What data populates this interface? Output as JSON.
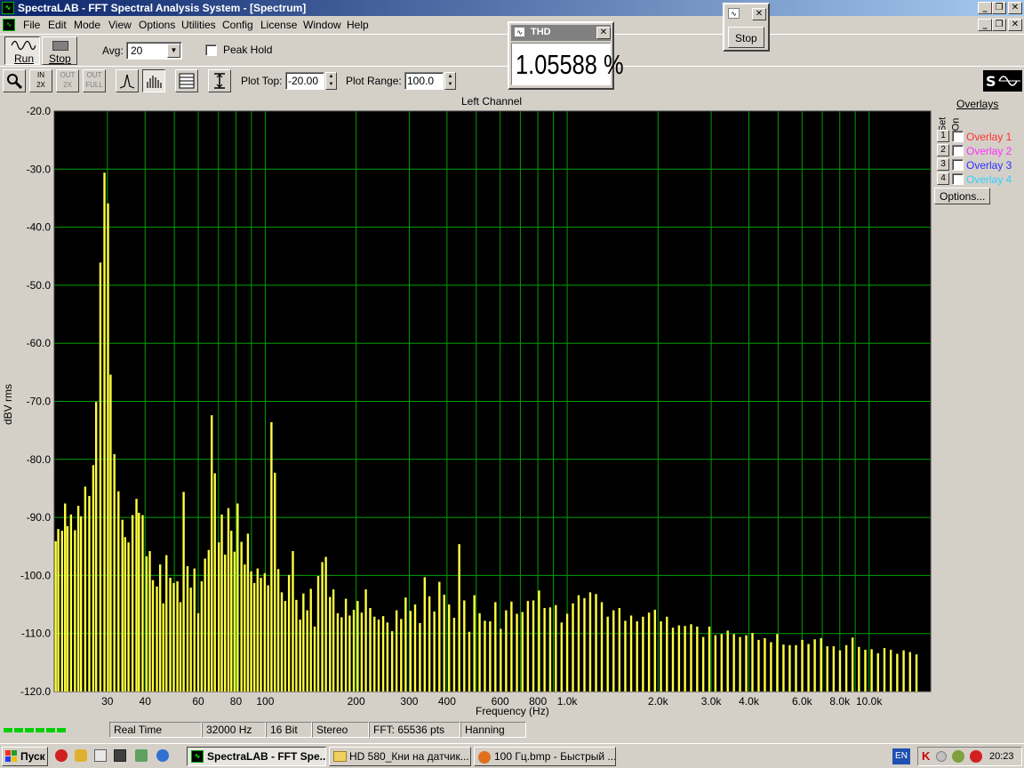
{
  "window": {
    "title": "SpectraLAB - FFT Spectral Analysis System - [Spectrum]"
  },
  "menu": [
    "File",
    "Edit",
    "Mode",
    "View",
    "Options",
    "Utilities",
    "Config",
    "License",
    "Window",
    "Help"
  ],
  "toolbar1": {
    "run_label": "Run",
    "stop_label": "Stop",
    "avg_label": "Avg:",
    "avg_value": "20",
    "peak_hold_label": "Peak Hold"
  },
  "toolbar2": {
    "plot_top_label": "Plot Top:",
    "plot_top_value": "-20.00",
    "plot_range_label": "Plot Range:",
    "plot_range_value": "100.0"
  },
  "thd_window": {
    "title": "THD",
    "value": "1.05588 %"
  },
  "stop_window": {
    "button_label": "Stop"
  },
  "overlays": {
    "title": "Overlays",
    "set_label": "Set",
    "on_label": "On",
    "items": [
      {
        "num": "1",
        "label": "Overlay 1",
        "color": "#ff3030"
      },
      {
        "num": "2",
        "label": "Overlay 2",
        "color": "#ff30ff"
      },
      {
        "num": "3",
        "label": "Overlay 3",
        "color": "#3030ff"
      },
      {
        "num": "4",
        "label": "Overlay 4",
        "color": "#30d0ff"
      }
    ],
    "options_label": "Options..."
  },
  "status": {
    "mode": "Real Time",
    "rate": "32000 Hz",
    "bits": "16 Bit",
    "channels": "Stereo",
    "fft": "FFT: 65536 pts",
    "window": "Hanning"
  },
  "taskbar": {
    "start_label": "Пуск",
    "tasks": [
      "SpectraLAB - FFT Spe...",
      "HD 580_Кни на датчик...",
      "100 Гц.bmp - Быстрый ..."
    ],
    "lang": "EN",
    "clock": "20:23"
  },
  "chart_data": {
    "type": "bar",
    "title": "Left Channel",
    "xlabel": "Frequency (Hz)",
    "ylabel": "dBV rms",
    "ylim": [
      -120,
      -20
    ],
    "xlim": [
      20,
      16000
    ],
    "x_scale": "log",
    "grid": true,
    "bar_color": "#ffff40",
    "background": "#000000",
    "grid_color": "#00a000",
    "yticks": [
      "-20.0",
      "-30.0",
      "-40.0",
      "-50.0",
      "-60.0",
      "-70.0",
      "-80.0",
      "-90.0",
      "-100.0",
      "-110.0",
      "-120.0"
    ],
    "xticks": [
      {
        "v": 30,
        "t": "30"
      },
      {
        "v": 40,
        "t": "40"
      },
      {
        "v": 60,
        "t": "60"
      },
      {
        "v": 80,
        "t": "80"
      },
      {
        "v": 100,
        "t": "100"
      },
      {
        "v": 200,
        "t": "200"
      },
      {
        "v": 300,
        "t": "300"
      },
      {
        "v": 400,
        "t": "400"
      },
      {
        "v": 600,
        "t": "600"
      },
      {
        "v": 800,
        "t": "800"
      },
      {
        "v": 1000,
        "t": "1.0k"
      },
      {
        "v": 2000,
        "t": "2.0k"
      },
      {
        "v": 3000,
        "t": "3.0k"
      },
      {
        "v": 4000,
        "t": "4.0k"
      },
      {
        "v": 6000,
        "t": "6.0k"
      },
      {
        "v": 8000,
        "t": "8.0k"
      },
      {
        "v": 10000,
        "t": "10.0k"
      }
    ],
    "x": [
      20.2,
      20.6,
      21.2,
      21.7,
      22.1,
      22.7,
      23.4,
      24,
      24.5,
      25.3,
      26.1,
      26.9,
      27.5,
      28.4,
      29.3,
      30.1,
      30.7,
      31.6,
      32.6,
      33.6,
      34.3,
      35.2,
      36.3,
      37.4,
      38.1,
      39.2,
      40.4,
      41.4,
      42.4,
      43.7,
      44.8,
      45.9,
      47,
      48.4,
      49.7,
      51.1,
      52.3,
      53.6,
      55.2,
      56.6,
      58.2,
      59.9,
      61.5,
      63.1,
      64.9,
      66.4,
      68,
      70.1,
      71.7,
      73.5,
      75.4,
      77.1,
      79,
      80.9,
      83.3,
      85.4,
      87.5,
      89.7,
      91.9,
      94.2,
      96.6,
      99.5,
      102.1,
      104.7,
      107.5,
      110.3,
      113.3,
      116.3,
      119.7,
      123.3,
      126.6,
      130.3,
      133.6,
      137.6,
      141.4,
      145.6,
      149.6,
      154.3,
      158.6,
      163.7,
      168,
      173.6,
      178.8,
      184.7,
      190.1,
      196.2,
      202.1,
      208.4,
      215.1,
      222.4,
      229.7,
      237.2,
      245.5,
      253.6,
      262.9,
      271.9,
      281.6,
      291.4,
      302.3,
      313.2,
      324.9,
      337,
      349.4,
      362.7,
      376.9,
      391.1,
      405.9,
      421.9,
      438.5,
      455.7,
      473.5,
      492.2,
      512.2,
      533.2,
      555,
      577.7,
      601.6,
      627,
      653.1,
      680.9,
      710,
      740.2,
      771.8,
      806,
      840.6,
      877.3,
      916,
      957.1,
      998.9,
      1043.6,
      1090,
      1139.5,
      1190.5,
      1244.8,
      1300.8,
      1360.9,
      1422.8,
      1487.8,
      1556.2,
      1627.2,
      1702.6,
      1781,
      1864.2,
      1950.9,
      2042.2,
      2137.8,
      2237.3,
      2343.7,
      2453.4,
      2570.5,
      2692.4,
      2820.4,
      2953.9,
      3094.2,
      3243.8,
      3399.2,
      3563.2,
      3734.1,
      3913.8,
      4103.7,
      4301.6,
      4510.9,
      4728.6,
      4958.7,
      5201.1,
      5453.7,
      5720.2,
      5999.5,
      6292.4,
      6601.7,
      6925.2,
      7265,
      7623.9,
      8000.2,
      8396.8,
      8810.4,
      9247.6,
      9706.5,
      10186.8,
      10694.6,
      11229.7,
      11790.8,
      12381.5,
      13001.9,
      13653.3,
      14339.7,
      15062.1,
      15823.4
    ],
    "y": [
      -94.1,
      -92,
      -92.3,
      -87.6,
      -91.5,
      -89.5,
      -92.2,
      -88,
      -89.8,
      -84.7,
      -86.3,
      -81,
      -70.1,
      -46.1,
      -30.6,
      -35.9,
      -65.4,
      -79.1,
      -85.5,
      -90.4,
      -93.4,
      -94.3,
      -89.6,
      -86.8,
      -89.2,
      -89.6,
      -96.7,
      -95.8,
      -100.8,
      -101.9,
      -98.1,
      -104.8,
      -96.5,
      -100.4,
      -101.3,
      -101,
      -104.6,
      -85.6,
      -98.4,
      -102.1,
      -98.8,
      -106.5,
      -101,
      -97.1,
      -95.6,
      -72.4,
      -82.4,
      -94.3,
      -89.5,
      -96.4,
      -88.4,
      -92.3,
      -95.9,
      -87.6,
      -94.2,
      -98.1,
      -92.8,
      -99.3,
      -101.3,
      -98.8,
      -100.4,
      -99.6,
      -101.7,
      -73.6,
      -82.3,
      -98.9,
      -102.9,
      -104.4,
      -99.9,
      -95.8,
      -104.2,
      -107.6,
      -103.1,
      -106,
      -102.3,
      -108.8,
      -100.1,
      -97.7,
      -96.8,
      -103.7,
      -102.4,
      -106.5,
      -107.2,
      -104,
      -106.9,
      -105.9,
      -104.4,
      -106.4,
      -102.4,
      -105.6,
      -107.1,
      -107.6,
      -107,
      -108.1,
      -109.6,
      -106,
      -107.5,
      -103.8,
      -106.1,
      -105,
      -108.2,
      -100.3,
      -103.6,
      -106.2,
      -101.1,
      -103.3,
      -105,
      -107.3,
      -94.6,
      -104.3,
      -109.7,
      -103.4,
      -106.5,
      -107.8,
      -107.9,
      -104.6,
      -109.2,
      -106,
      -104.5,
      -106.6,
      -106.3,
      -104.4,
      -104.3,
      -102.6,
      -105.6,
      -105.5,
      -105.1,
      -108.1,
      -106.6,
      -104.8,
      -103.4,
      -103.9,
      -102.9,
      -103.2,
      -104.6,
      -107.1,
      -106,
      -105.6,
      -107.8,
      -106.9,
      -107.9,
      -107.1,
      -106.4,
      -105.9,
      -107.9,
      -107.1,
      -109,
      -108.6,
      -108.7,
      -108.4,
      -108.8,
      -110.6,
      -108.8,
      -110.3,
      -110.1,
      -109.5,
      -110.1,
      -110.6,
      -110.3,
      -109.9,
      -111.1,
      -110.8,
      -111.5,
      -110.1,
      -111.9,
      -112,
      -112,
      -111.1,
      -111.8,
      -111,
      -110.8,
      -112.2,
      -112.2,
      -112.9,
      -112,
      -110.7,
      -112.3,
      -112.8,
      -112.7,
      -113.4,
      -112.5,
      -112.8,
      -113.5,
      -112.9,
      -113.2,
      -113.6
    ]
  }
}
